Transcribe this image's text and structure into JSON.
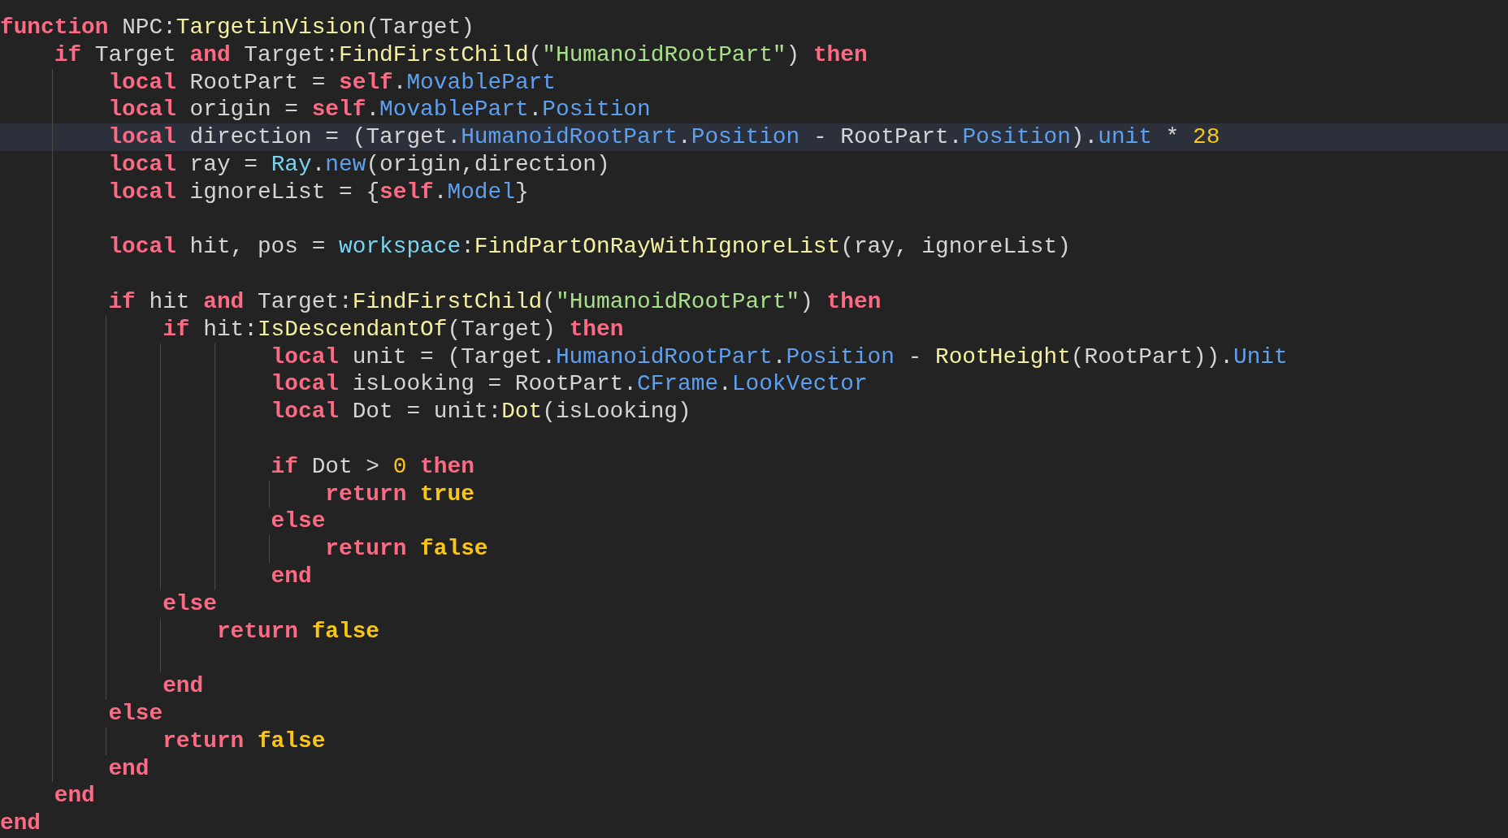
{
  "editor": {
    "lines": [
      {
        "highlighted": false,
        "tokens": [
          {
            "kind": "keyword",
            "text": "function"
          },
          {
            "kind": "plain",
            "text": " NPC:"
          },
          {
            "kind": "function",
            "text": "TargetinVision"
          },
          {
            "kind": "plain",
            "text": "(Target)"
          }
        ]
      },
      {
        "highlighted": false,
        "tokens": [
          {
            "kind": "keyword",
            "text": "    if"
          },
          {
            "kind": "plain",
            "text": " Target "
          },
          {
            "kind": "keyword",
            "text": "and"
          },
          {
            "kind": "plain",
            "text": " Target:"
          },
          {
            "kind": "function",
            "text": "FindFirstChild"
          },
          {
            "kind": "plain",
            "text": "("
          },
          {
            "kind": "string",
            "text": "\"HumanoidRootPart\""
          },
          {
            "kind": "plain",
            "text": ") "
          },
          {
            "kind": "keyword",
            "text": "then"
          }
        ]
      },
      {
        "highlighted": false,
        "tokens": [
          {
            "kind": "keyword",
            "text": "        local"
          },
          {
            "kind": "plain",
            "text": " RootPart = "
          },
          {
            "kind": "keyword",
            "text": "self"
          },
          {
            "kind": "plain",
            "text": "."
          },
          {
            "kind": "property",
            "text": "MovablePart"
          }
        ]
      },
      {
        "highlighted": false,
        "tokens": [
          {
            "kind": "keyword",
            "text": "        local"
          },
          {
            "kind": "plain",
            "text": " origin = "
          },
          {
            "kind": "keyword",
            "text": "self"
          },
          {
            "kind": "plain",
            "text": "."
          },
          {
            "kind": "property",
            "text": "MovablePart"
          },
          {
            "kind": "plain",
            "text": "."
          },
          {
            "kind": "property",
            "text": "Position"
          }
        ]
      },
      {
        "highlighted": true,
        "tokens": [
          {
            "kind": "keyword",
            "text": "        local"
          },
          {
            "kind": "plain",
            "text": " direction = (Target."
          },
          {
            "kind": "property",
            "text": "HumanoidRootPart"
          },
          {
            "kind": "plain",
            "text": "."
          },
          {
            "kind": "property",
            "text": "Position"
          },
          {
            "kind": "plain",
            "text": " - RootPart."
          },
          {
            "kind": "property",
            "text": "Position"
          },
          {
            "kind": "plain",
            "text": ")."
          },
          {
            "kind": "property",
            "text": "unit"
          },
          {
            "kind": "plain",
            "text": " * "
          },
          {
            "kind": "number",
            "text": "28"
          }
        ]
      },
      {
        "highlighted": false,
        "tokens": [
          {
            "kind": "keyword",
            "text": "        local"
          },
          {
            "kind": "plain",
            "text": " ray = "
          },
          {
            "kind": "global",
            "text": "Ray"
          },
          {
            "kind": "plain",
            "text": "."
          },
          {
            "kind": "property",
            "text": "new"
          },
          {
            "kind": "plain",
            "text": "(origin,direction)"
          }
        ]
      },
      {
        "highlighted": false,
        "tokens": [
          {
            "kind": "keyword",
            "text": "        local"
          },
          {
            "kind": "plain",
            "text": " ignoreList = {"
          },
          {
            "kind": "keyword",
            "text": "self"
          },
          {
            "kind": "plain",
            "text": "."
          },
          {
            "kind": "property",
            "text": "Model"
          },
          {
            "kind": "plain",
            "text": "}"
          }
        ]
      },
      {
        "highlighted": false
      },
      {
        "highlighted": false,
        "tokens": [
          {
            "kind": "keyword",
            "text": "        local"
          },
          {
            "kind": "plain",
            "text": " hit, pos = "
          },
          {
            "kind": "global",
            "text": "workspace"
          },
          {
            "kind": "plain",
            "text": ":"
          },
          {
            "kind": "function",
            "text": "FindPartOnRayWithIgnoreList"
          },
          {
            "kind": "plain",
            "text": "(ray, ignoreList)"
          }
        ]
      },
      {
        "highlighted": false
      },
      {
        "highlighted": false,
        "tokens": [
          {
            "kind": "keyword",
            "text": "        if"
          },
          {
            "kind": "plain",
            "text": " hit "
          },
          {
            "kind": "keyword",
            "text": "and"
          },
          {
            "kind": "plain",
            "text": " Target:"
          },
          {
            "kind": "function",
            "text": "FindFirstChild"
          },
          {
            "kind": "plain",
            "text": "("
          },
          {
            "kind": "string",
            "text": "\"HumanoidRootPart\""
          },
          {
            "kind": "plain",
            "text": ") "
          },
          {
            "kind": "keyword",
            "text": "then"
          }
        ]
      },
      {
        "highlighted": false,
        "tokens": [
          {
            "kind": "keyword",
            "text": "            if"
          },
          {
            "kind": "plain",
            "text": " hit:"
          },
          {
            "kind": "function",
            "text": "IsDescendantOf"
          },
          {
            "kind": "plain",
            "text": "(Target) "
          },
          {
            "kind": "keyword",
            "text": "then"
          }
        ]
      },
      {
        "highlighted": false,
        "tokens": [
          {
            "kind": "keyword",
            "text": "                    local"
          },
          {
            "kind": "plain",
            "text": " unit = (Target."
          },
          {
            "kind": "property",
            "text": "HumanoidRootPart"
          },
          {
            "kind": "plain",
            "text": "."
          },
          {
            "kind": "property",
            "text": "Position"
          },
          {
            "kind": "plain",
            "text": " - "
          },
          {
            "kind": "function",
            "text": "RootHeight"
          },
          {
            "kind": "plain",
            "text": "(RootPart))."
          },
          {
            "kind": "property",
            "text": "Unit"
          }
        ]
      },
      {
        "highlighted": false,
        "tokens": [
          {
            "kind": "keyword",
            "text": "                    local"
          },
          {
            "kind": "plain",
            "text": " isLooking = RootPart."
          },
          {
            "kind": "property",
            "text": "CFrame"
          },
          {
            "kind": "plain",
            "text": "."
          },
          {
            "kind": "property",
            "text": "LookVector"
          }
        ]
      },
      {
        "highlighted": false,
        "tokens": [
          {
            "kind": "keyword",
            "text": "                    local"
          },
          {
            "kind": "plain",
            "text": " Dot = unit:"
          },
          {
            "kind": "function",
            "text": "Dot"
          },
          {
            "kind": "plain",
            "text": "(isLooking)"
          }
        ]
      },
      {
        "highlighted": false
      },
      {
        "highlighted": false,
        "tokens": [
          {
            "kind": "keyword",
            "text": "                    if"
          },
          {
            "kind": "plain",
            "text": " Dot > "
          },
          {
            "kind": "number",
            "text": "0"
          },
          {
            "kind": "keyword",
            "text": " then"
          }
        ]
      },
      {
        "highlighted": false,
        "tokens": [
          {
            "kind": "keyword",
            "text": "                        return"
          },
          {
            "kind": "constant",
            "text": " true"
          }
        ]
      },
      {
        "highlighted": false,
        "tokens": [
          {
            "kind": "keyword",
            "text": "                    else"
          }
        ]
      },
      {
        "highlighted": false,
        "tokens": [
          {
            "kind": "keyword",
            "text": "                        return"
          },
          {
            "kind": "constant",
            "text": " false"
          }
        ]
      },
      {
        "highlighted": false,
        "tokens": [
          {
            "kind": "keyword",
            "text": "                    end"
          }
        ]
      },
      {
        "highlighted": false,
        "tokens": [
          {
            "kind": "keyword",
            "text": "            else"
          }
        ]
      },
      {
        "highlighted": false,
        "tokens": [
          {
            "kind": "keyword",
            "text": "                return"
          },
          {
            "kind": "constant",
            "text": " false"
          }
        ]
      },
      {
        "highlighted": false
      },
      {
        "highlighted": false,
        "tokens": [
          {
            "kind": "keyword",
            "text": "            end"
          }
        ]
      },
      {
        "highlighted": false,
        "tokens": [
          {
            "kind": "keyword",
            "text": "        else"
          }
        ]
      },
      {
        "highlighted": false,
        "tokens": [
          {
            "kind": "keyword",
            "text": "            return"
          },
          {
            "kind": "constant",
            "text": " false"
          }
        ]
      },
      {
        "highlighted": false,
        "tokens": [
          {
            "kind": "keyword",
            "text": "        end"
          }
        ]
      },
      {
        "highlighted": false,
        "tokens": [
          {
            "kind": "keyword",
            "text": "    end"
          }
        ]
      },
      {
        "highlighted": false,
        "tokens": [
          {
            "kind": "keyword",
            "text": "end"
          }
        ]
      }
    ]
  }
}
